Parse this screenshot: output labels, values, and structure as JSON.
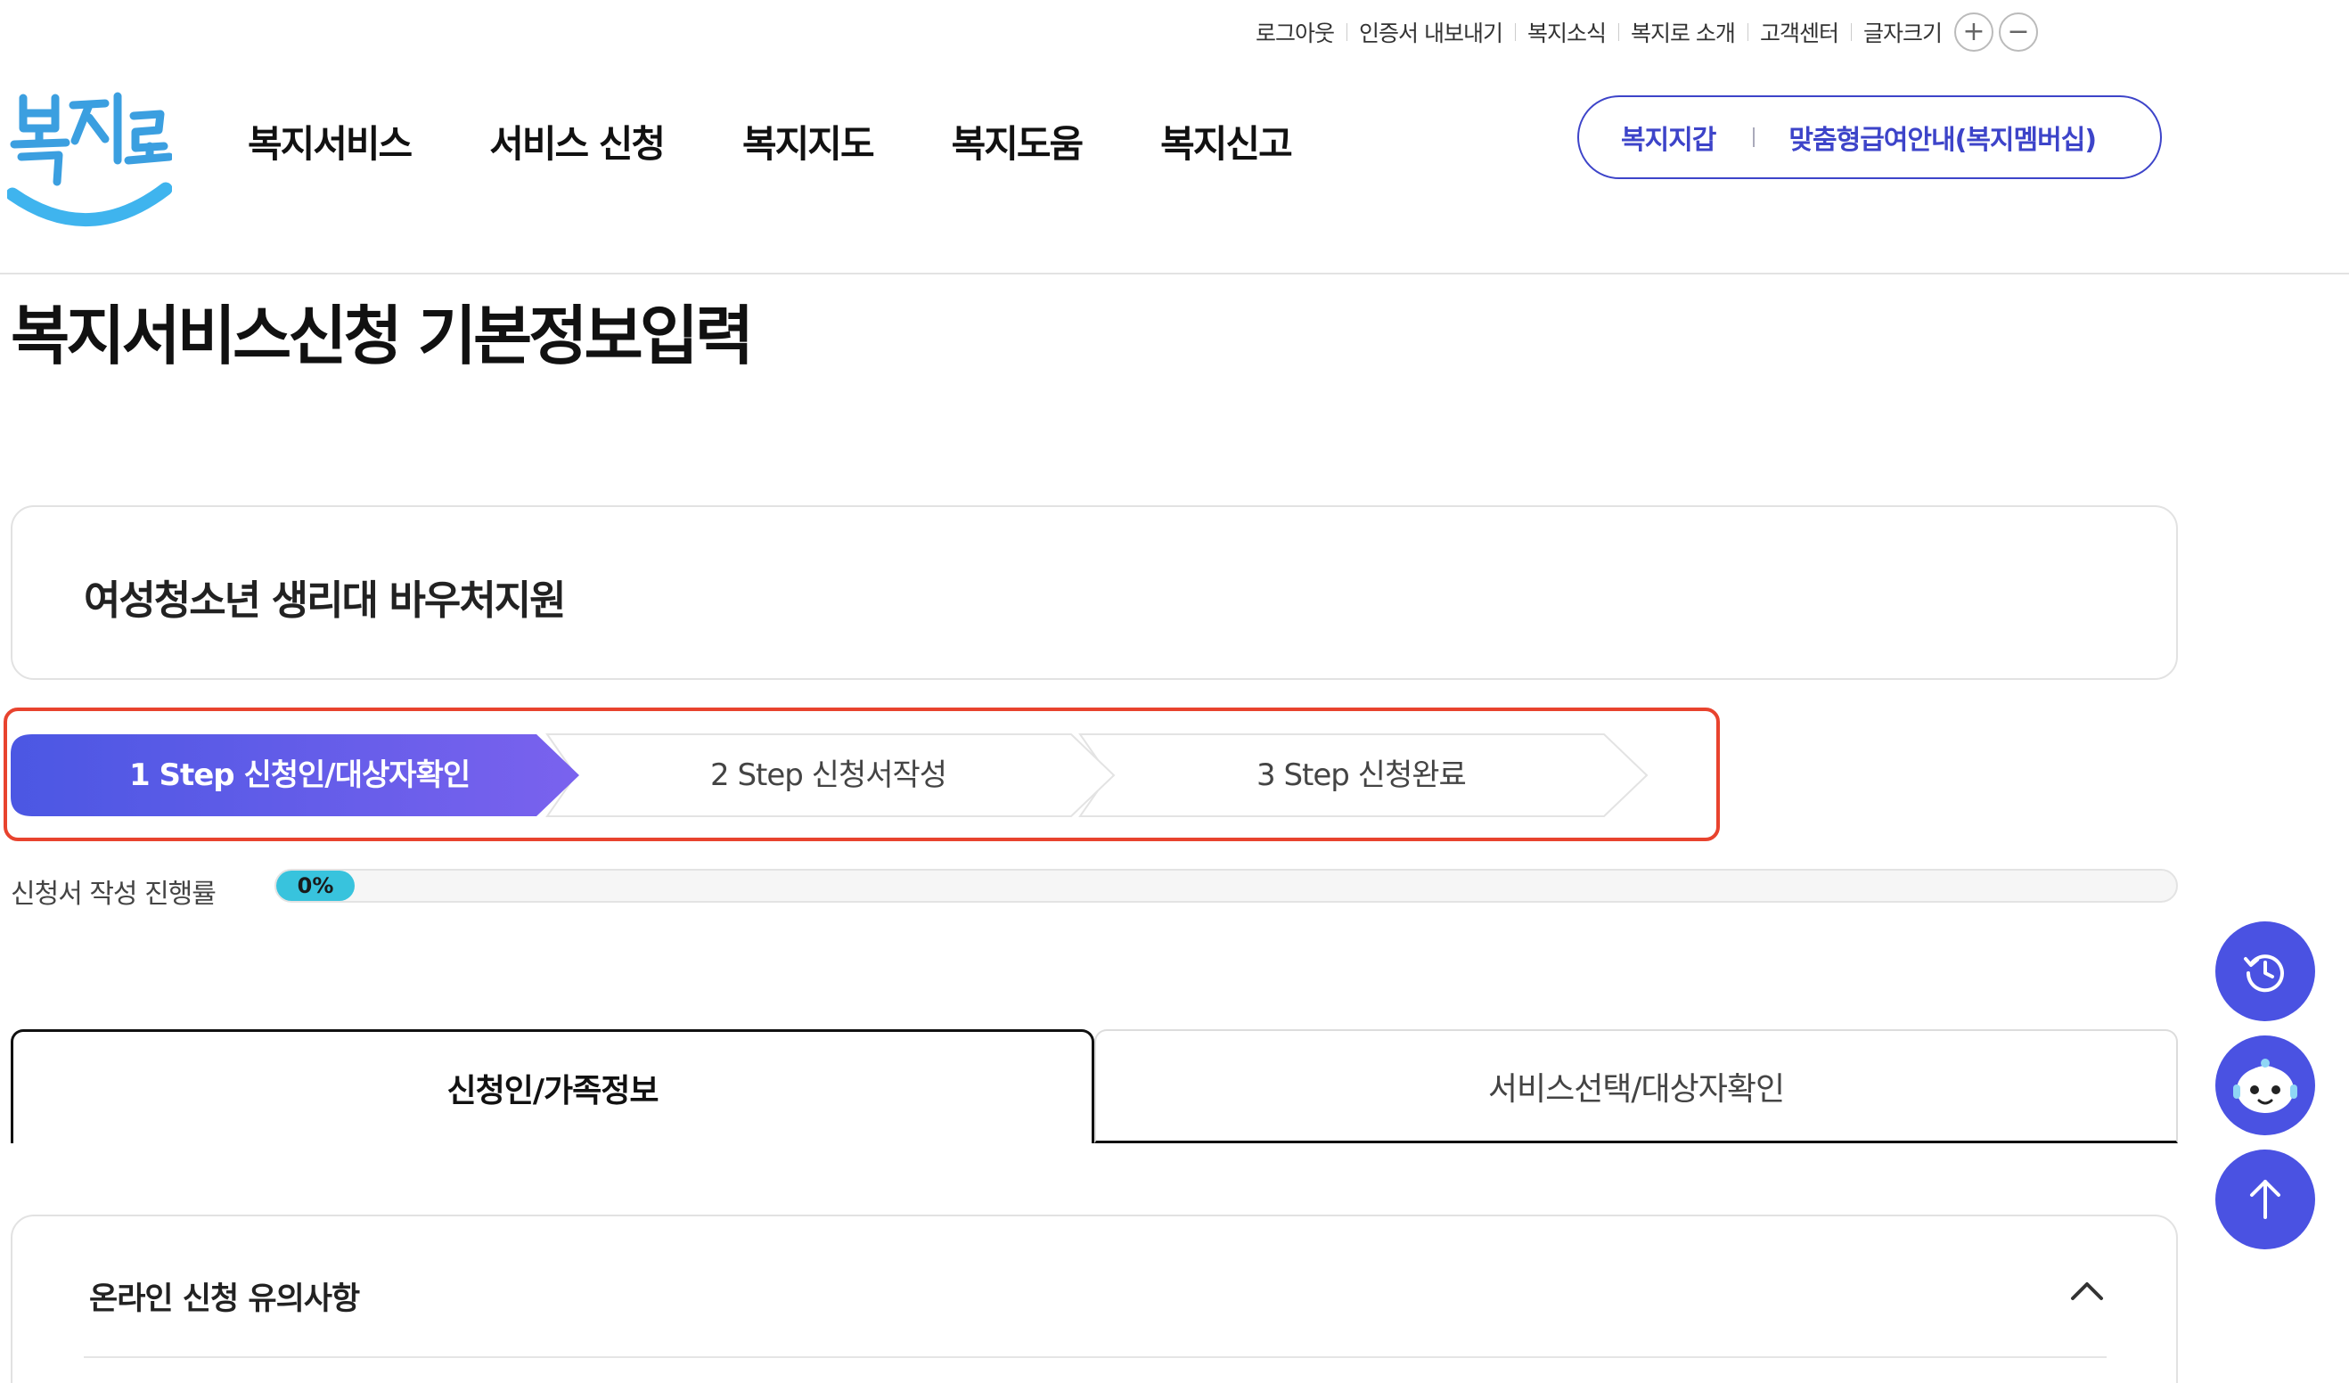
{
  "utility": {
    "links": [
      "로그아웃",
      "인증서 내보내기",
      "복지소식",
      "복지로 소개",
      "고객센터"
    ],
    "font_size_label": "글자크기",
    "font_plus": "+",
    "font_minus": "−"
  },
  "header": {
    "logo_text": "복지로",
    "nav": [
      "복지서비스",
      "서비스 신청",
      "복지지도",
      "복지도움",
      "복지신고"
    ],
    "quick_links": [
      "복지지갑",
      "맞춤형급여안내(복지멤버십)"
    ]
  },
  "page_title": "복지서비스신청 기본정보입력",
  "service_name": "여성청소년 생리대 바우처지원",
  "steps": [
    {
      "label": "1 Step 신청인/대상자확인",
      "active": true
    },
    {
      "label": "2 Step 신청서작성",
      "active": false
    },
    {
      "label": "3 Step 신청완료",
      "active": false
    }
  ],
  "progress": {
    "label": "신청서 작성 진행률",
    "value": "0%",
    "percent": 0
  },
  "tabs": [
    {
      "label": "신청인/가족정보",
      "active": true
    },
    {
      "label": "서비스선택/대상자확인",
      "active": false
    }
  ],
  "notice": {
    "title": "온라인 신청 유의사항"
  },
  "floating": [
    "history-icon",
    "chatbot-icon",
    "arrow-up-icon"
  ],
  "colors": {
    "primary": "#3d44c9",
    "step_active": "#5b5ee6",
    "highlight_border": "#e8432e",
    "progress_fill": "#38c3dd",
    "fab": "#4a52e2"
  }
}
